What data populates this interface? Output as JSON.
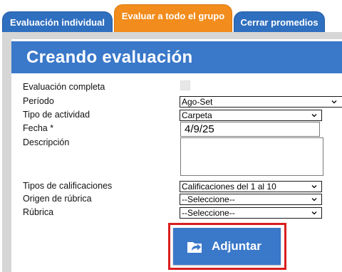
{
  "tabs": [
    {
      "label": "Evaluación individual",
      "active": false
    },
    {
      "label": "Evaluar a todo el grupo",
      "active": true
    },
    {
      "label": "Cerrar promedios",
      "active": false
    }
  ],
  "header": {
    "title": "Creando evaluación"
  },
  "form": {
    "evaluacion_completa": {
      "label": "Evaluación completa",
      "checked": false
    },
    "periodo": {
      "label": "Período",
      "value": "Ago-Set"
    },
    "tipo_actividad": {
      "label": "Tipo de actividad",
      "value": "Carpeta"
    },
    "fecha": {
      "label": "Fecha *",
      "value": "4/9/25"
    },
    "descripcion": {
      "label": "Descripción",
      "value": ""
    },
    "tipos_calificaciones": {
      "label": "Tipos de calificaciones",
      "value": "Calificaciones del 1 al 10"
    },
    "origen_rubrica": {
      "label": "Origen de rúbrica",
      "value": "--Seleccione--"
    },
    "rubrica": {
      "label": "Rúbrica",
      "value": "--Seleccione--"
    }
  },
  "actions": {
    "attach_label": "Adjuntar"
  },
  "colors": {
    "tab_blue": "#2f6fbf",
    "tab_orange": "#f28c1c",
    "header_blue": "#3a78c9",
    "highlight_red": "#d81e1e"
  },
  "icons": {
    "attach": "upload-folder-icon",
    "dropdown": "chevron-down-icon"
  }
}
